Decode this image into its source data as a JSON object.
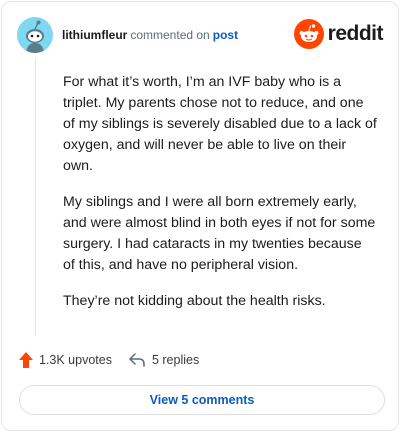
{
  "comment": {
    "username": "lithiumfleur",
    "action": "commented on",
    "post_link": "post",
    "avatar_icon": "snoo-avatar-icon",
    "paragraphs": [
      "For what it’s worth, I’m an IVF baby who is a triplet. My parents chose not to reduce, and one of my siblings is severely disabled due to a lack of oxygen, and will never be able to live on their own.",
      "My siblings and I were all born extremely early, and were almost blind in both eyes if not for some surgery. I had cataracts in my twenties because of this, and have no peripheral vision.",
      "They’re not kidding about the health risks."
    ]
  },
  "brand": {
    "name": "reddit",
    "logo_icon": "reddit-logo-icon",
    "color": "#ff4500"
  },
  "actions": {
    "upvotes": "1.3K upvotes",
    "upvote_icon": "upvote-arrow-icon",
    "replies": "5 replies",
    "reply_icon": "reply-arrow-icon"
  },
  "view_comments": "View 5 comments",
  "colors": {
    "link": "#0b5cbd",
    "upvote": "#ff4500",
    "avatar_bg": "#7fd8f2"
  }
}
